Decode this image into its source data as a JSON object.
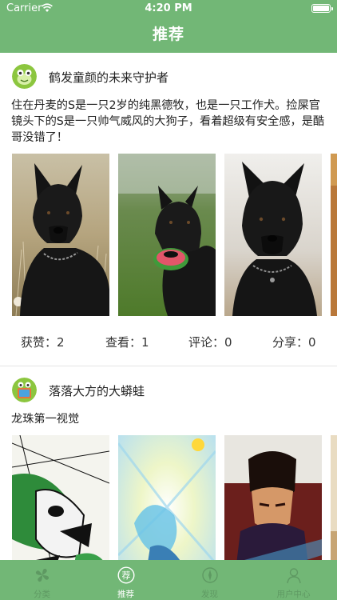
{
  "status_bar": {
    "carrier": "Carrier",
    "time": "4:20 PM"
  },
  "nav": {
    "title": "推荐"
  },
  "posts": [
    {
      "author": "鹤发童颜的未来守护者",
      "text": "住在丹麦的S是一只2岁的纯黑德牧，也是一只工作犬。捡屎官镜头下的S是一只帅气威风的大狗子，看着超级有安全感，是酷哥没错了！",
      "images": [
        "black-shepherd-in-grass",
        "black-shepherd-with-watermelon",
        "black-shepherd-portrait",
        "autumn-photo-partial"
      ],
      "stats": {
        "likes": "获赞：2",
        "views": "查看：1",
        "comments": "评论：0",
        "shares": "分享：0"
      }
    },
    {
      "author": "落落大方的大蟒蛙",
      "text": "龙珠第一视觉",
      "images": [
        "dragonball-manga-panel",
        "dragonball-ki-blast",
        "dragonball-android-art",
        "dragonball-partial"
      ]
    }
  ],
  "tabbar": {
    "items": [
      {
        "label": "分类",
        "icon": "category-icon",
        "active": false
      },
      {
        "label": "推荐",
        "icon": "recommend-icon",
        "active": true
      },
      {
        "label": "发现",
        "icon": "discover-icon",
        "active": false
      },
      {
        "label": "用户中心",
        "icon": "user-icon",
        "active": false
      }
    ]
  },
  "colors": {
    "primary": "#72b776",
    "tab_dim": "#27412a",
    "text": "#222222"
  }
}
